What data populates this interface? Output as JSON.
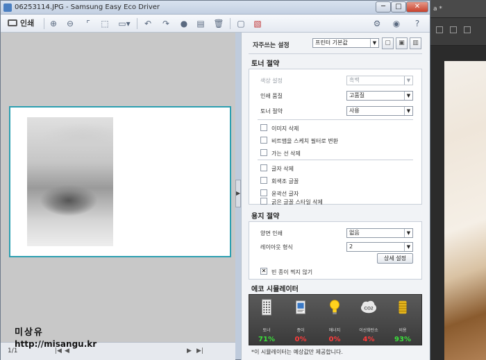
{
  "window": {
    "title": "06253114.JPG - Samsung Easy Eco Driver",
    "min_label": "─",
    "max_label": "□",
    "close_label": "✕"
  },
  "background_app": {
    "tab_label": "a *"
  },
  "toolbar": {
    "print_label": "인쇄"
  },
  "preview": {
    "page_indicator": "1/1",
    "nav_first": "|◀",
    "nav_prev": "◀",
    "nav_next": "▶",
    "nav_last": "▶|",
    "handle": "▶"
  },
  "watermark": {
    "name": "미상유",
    "url": "http://misangu.kr"
  },
  "panel": {
    "favorites": {
      "label": "자주쓰는 설정",
      "value": "프린터 기본값"
    },
    "toner_saving": {
      "header": "토너 절약",
      "color_label": "색상 설정",
      "color_value": "흑백",
      "quality_label": "인쇄 품질",
      "quality_value": "고품질",
      "toner_label": "토너 절약",
      "toner_value": "사용",
      "checks": [
        {
          "label": "이미지 삭제",
          "checked": false
        },
        {
          "label": "비트맵을 스케치 필터로 변환",
          "checked": false
        },
        {
          "label": "가는 선 삭제",
          "checked": false
        },
        {
          "label": "글자 삭제",
          "checked": false
        },
        {
          "label": "회색조 글꼴",
          "checked": false
        },
        {
          "label": "윤곽선 글자",
          "checked": false
        },
        {
          "label": "굵은 글꼴 스타일 삭제",
          "checked": false
        }
      ]
    },
    "paper_saving": {
      "header": "용지 절약",
      "duplex_label": "양면 인쇄",
      "duplex_value": "없음",
      "layout_label": "레이아웃 형식",
      "layout_value": "2",
      "detail_button": "상세 설정",
      "skip_blank_label": "빈 종이 찍지 않기",
      "skip_blank_checked": true,
      "check_mark": "✕"
    },
    "eco_simulator": {
      "header": "에코 시뮬레이터",
      "items": [
        {
          "label": "토너",
          "value": "71%",
          "color": "#3be03b",
          "icon": "toner-icon"
        },
        {
          "label": "종이",
          "value": "0%",
          "color": "#ff3b3b",
          "icon": "paper-icon"
        },
        {
          "label": "에너지",
          "value": "0%",
          "color": "#ff3b3b",
          "icon": "energy-bulb-icon"
        },
        {
          "label": "이산화탄소",
          "value": "4%",
          "color": "#ff3b3b",
          "icon": "co2-cloud-icon"
        },
        {
          "label": "비용",
          "value": "93%",
          "color": "#3be03b",
          "icon": "coins-icon"
        }
      ],
      "co2_text": "CO2",
      "note": "*이 시뮬레이터는 예상값만 제공합니다."
    }
  }
}
